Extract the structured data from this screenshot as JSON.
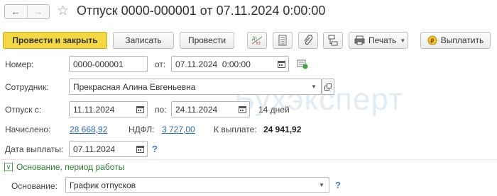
{
  "window": {
    "title": "Отпуск 0000-000001 от 07.11.2024 0:00:00"
  },
  "nav": {
    "back": "←",
    "forward": "→"
  },
  "toolbar": {
    "post_close": "Провести и закрыть",
    "save": "Записать",
    "post": "Провести",
    "print": "Печать",
    "pay": "Выплатить"
  },
  "form": {
    "number_label": "Номер:",
    "number_value": "0000-000001",
    "from_label": "от:",
    "from_value": "07.11.2024  0:00:00",
    "employee_label": "Сотрудник:",
    "employee_value": "Прекрасная Алина Евгеньевна",
    "leave_from_label": "Отпуск с:",
    "leave_from_value": "11.11.2024",
    "to_label": "по:",
    "to_value": "24.11.2024",
    "days": "14 дней",
    "accrued_label": "Начислено:",
    "accrued_value": "28 668,92",
    "ndfl_label": "НДФЛ:",
    "ndfl_value": "3 727,00",
    "payout_label": "К выплате:",
    "payout_value": "24 941,92",
    "paydate_label": "Дата выплаты:",
    "paydate_value": "07.11.2024",
    "help": "?"
  },
  "section": {
    "title": "Основание, период работы",
    "basis_label": "Основание:",
    "basis_value": "График отпусков",
    "help": "?"
  },
  "watermark": "Бухэксперт",
  "colors": {
    "primary_button": "#f4d843",
    "link": "#2d6ca9",
    "section": "#2e7d32"
  }
}
